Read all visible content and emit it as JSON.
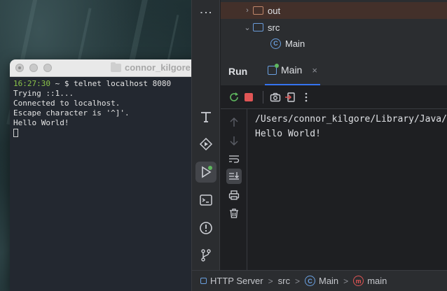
{
  "terminal": {
    "title": "connor_kilgore",
    "prompt_time": "16:27:30",
    "prompt_rest": " ~ $ telnet localhost 8080",
    "lines": [
      "Trying ::1...",
      "Connected to localhost.",
      "Escape character is '^]'.",
      "Hello World!"
    ]
  },
  "ide": {
    "more_icon": "⋮",
    "tree": {
      "out": "out",
      "src": "src",
      "main_class": "Main",
      "class_glyph": "C"
    },
    "run_panel": {
      "title": "Run",
      "tab_label": "Main",
      "tab_close": "×"
    },
    "console": {
      "lines": [
        "/Users/connor_kilgore/Library/Java/JavaVirtualMachines",
        "Hello World!"
      ]
    },
    "statusbar": {
      "module": "HTTP Server",
      "src": "src",
      "class": "Main",
      "method": "main",
      "class_glyph": "C",
      "method_glyph": "m",
      "sep": ">"
    },
    "accent": "#3574f0",
    "stop_color": "#e05555",
    "running_dot": "#5fb85f"
  }
}
